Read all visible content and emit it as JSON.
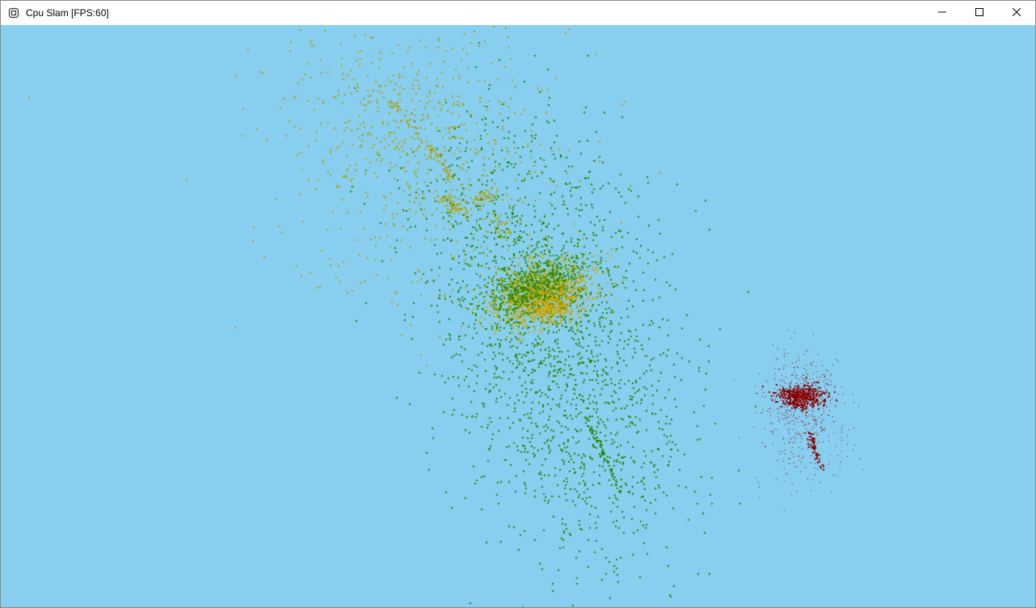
{
  "window": {
    "title": "Cpu Slam [FPS:60]",
    "icon": "app-icon",
    "controls": {
      "minimize_icon": "minimize-icon",
      "maximize_icon": "maximize-icon",
      "close_icon": "close-icon"
    }
  },
  "viewport": {
    "background_color": "#87ceef",
    "point_clouds": [
      {
        "name_hint": "olive-cloud",
        "color": "#b0a000"
      },
      {
        "name_hint": "green-cloud",
        "color": "#1f8a00"
      },
      {
        "name_hint": "red-cloud",
        "color": "#8b0000"
      }
    ]
  }
}
